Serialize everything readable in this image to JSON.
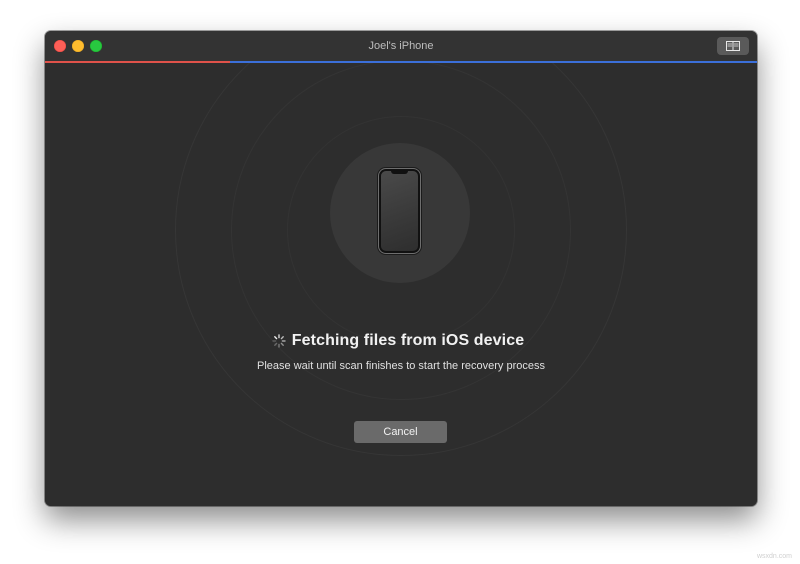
{
  "window": {
    "title": "Joel's iPhone",
    "controls": {
      "close_icon": "close-dot-icon",
      "minimize_icon": "minimize-dot-icon",
      "zoom_icon": "zoom-dot-icon",
      "sidebar_toggle_icon": "sidebar-toggle-icon"
    }
  },
  "progress": {
    "fraction": 0.26,
    "fill_color": "#e0524a",
    "track_color": "#3b6fd9"
  },
  "main": {
    "device_icon": "iphone-icon",
    "spinner_icon": "spinner-icon",
    "heading": "Fetching files from iOS device",
    "subtext": "Please wait until scan finishes to start the recovery process",
    "cancel_label": "Cancel"
  },
  "watermark": "wsxdn.com",
  "colors": {
    "background": "#2d2d2d",
    "button": "#6a6a6a",
    "text": "#f2f2f2"
  }
}
